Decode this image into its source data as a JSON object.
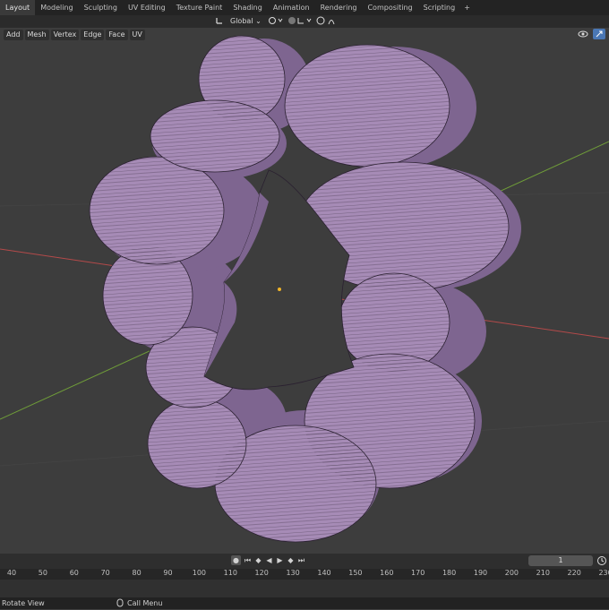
{
  "tabs": [
    "Layout",
    "Modeling",
    "Sculpting",
    "UV Editing",
    "Texture Paint",
    "Shading",
    "Animation",
    "Rendering",
    "Compositing",
    "Scripting",
    "+"
  ],
  "active_tab": "Layout",
  "header": {
    "orientation_label": "Global"
  },
  "viewport_menus": [
    "Add",
    "Mesh",
    "Vertex",
    "Edge",
    "Face",
    "UV"
  ],
  "timeline": {
    "current_frame": "1",
    "ticks": [
      "40",
      "50",
      "60",
      "70",
      "80",
      "90",
      "100",
      "110",
      "120",
      "130",
      "140",
      "150",
      "160",
      "170",
      "180",
      "190",
      "200",
      "210",
      "220",
      "230"
    ]
  },
  "status": {
    "left": "Rotate View",
    "middle": "Call Menu"
  },
  "colors": {
    "mesh_face": "#a68bb6",
    "mesh_side": "#7e6590",
    "background": "#3d3d3d",
    "x_axis": "#b44a4a",
    "y_axis": "#6f9c39"
  }
}
